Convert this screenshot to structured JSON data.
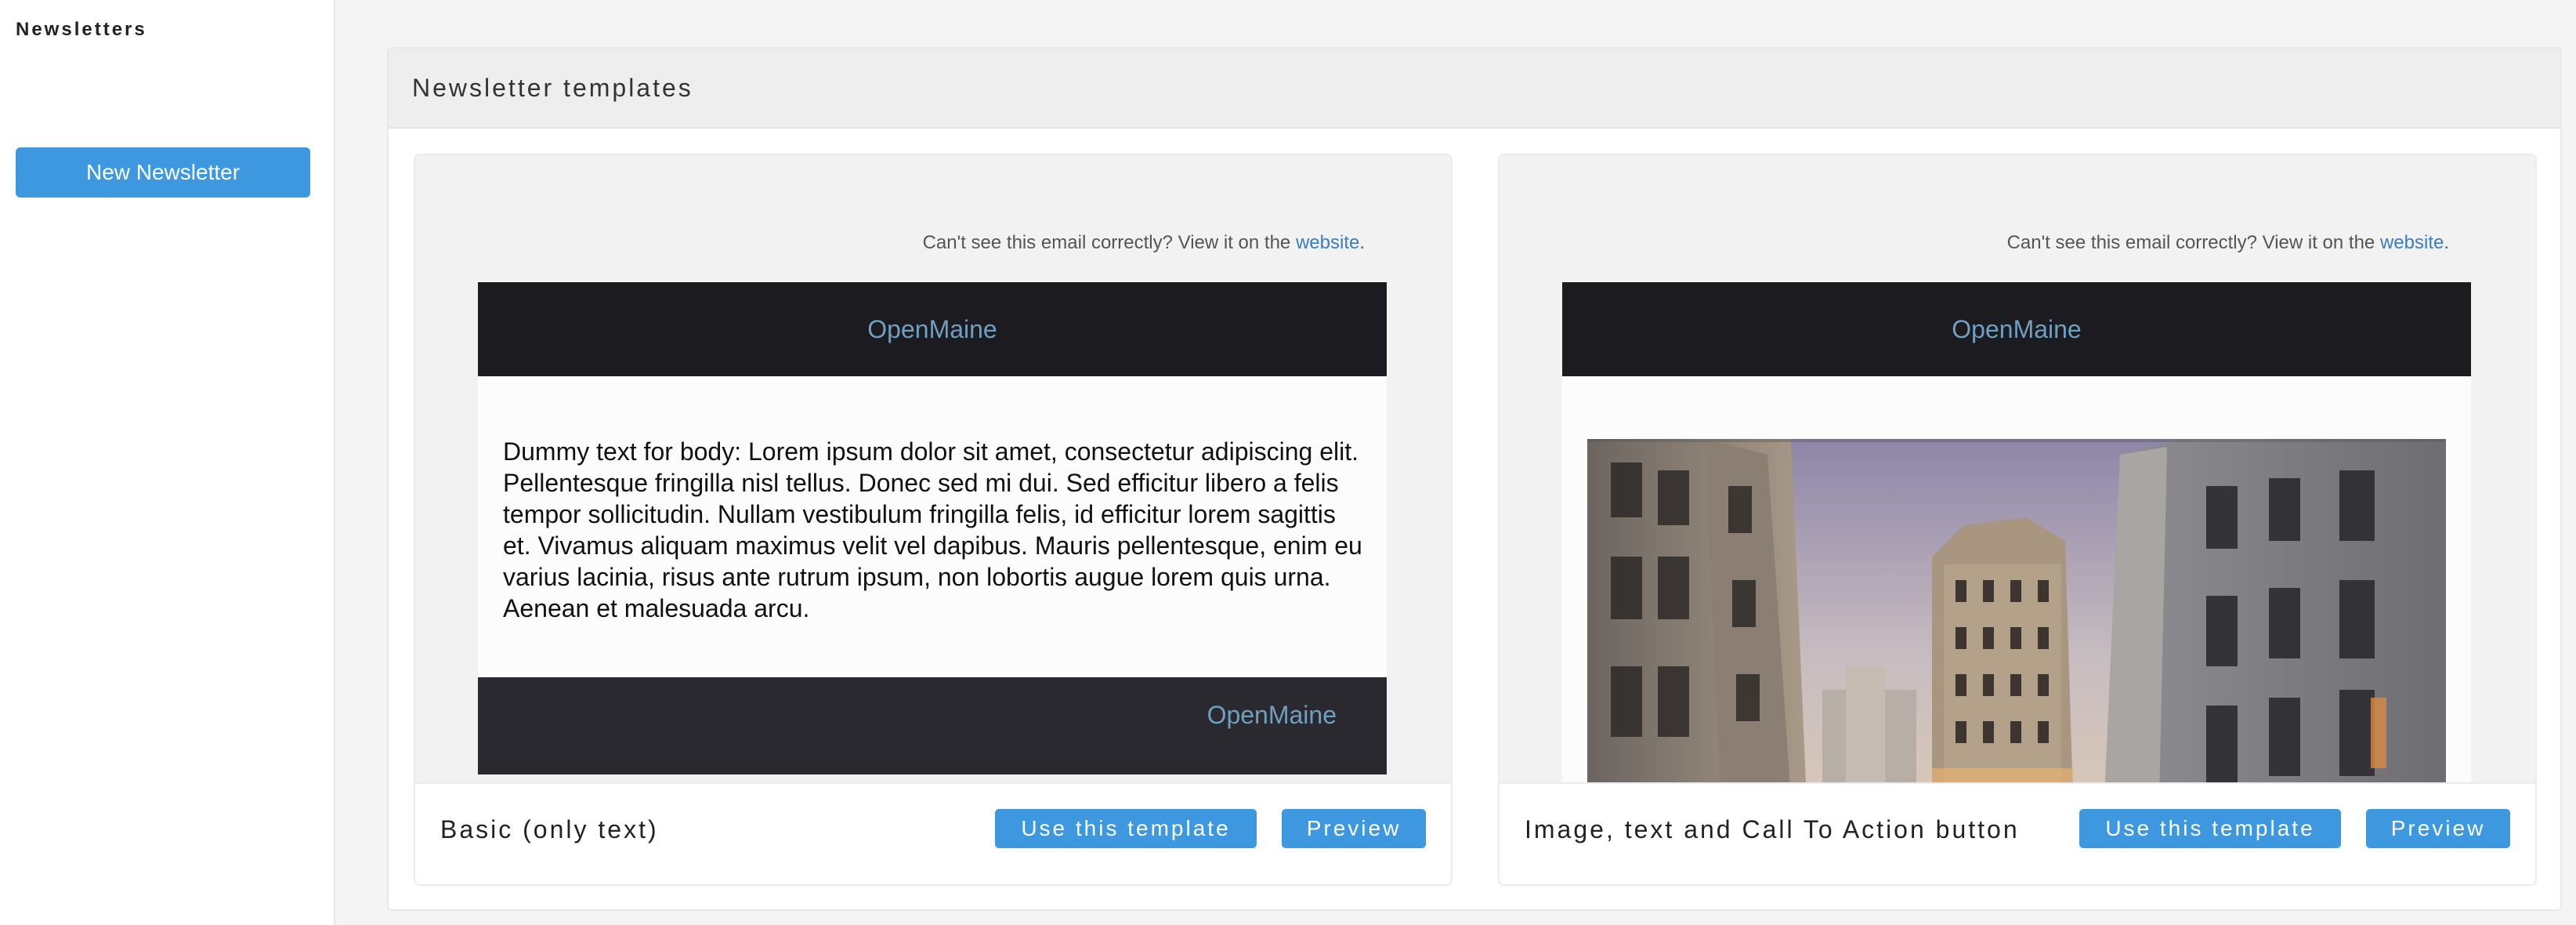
{
  "sidebar": {
    "title": "Newsletters",
    "new_button": "New Newsletter"
  },
  "panel": {
    "title": "Newsletter templates"
  },
  "templates": [
    {
      "preheader_text": "Can't see this email correctly? View it on the ",
      "preheader_link": "website",
      "preheader_end": ".",
      "brand": "OpenMaine",
      "body": "Dummy text for body: Lorem ipsum dolor sit amet, consectetur adipiscing elit. Pellentesque fringilla nisl tellus. Donec sed mi dui. Sed efficitur libero a felis tempor sollicitudin. Nullam vestibulum fringilla felis, id efficitur lorem sagittis et. Vivamus aliquam maximus velit vel dapibus. Mauris pellentesque, enim eu varius lacinia, risus ante rutrum ipsum, non lobortis augue lorem quis urna. Aenean et malesuada arcu.",
      "footer_brand": "OpenMaine",
      "name": "Basic (only text)",
      "use_label": "Use this template",
      "preview_label": "Preview"
    },
    {
      "preheader_text": "Can't see this email correctly? View it on the ",
      "preheader_link": "website",
      "preheader_end": ".",
      "brand": "OpenMaine",
      "name": "Image, text and Call To Action button",
      "use_label": "Use this template",
      "preview_label": "Preview"
    }
  ],
  "colors": {
    "accent": "#3d98e0",
    "brand_text": "#6fa0c0",
    "email_header_bg": "#1c1b20"
  }
}
